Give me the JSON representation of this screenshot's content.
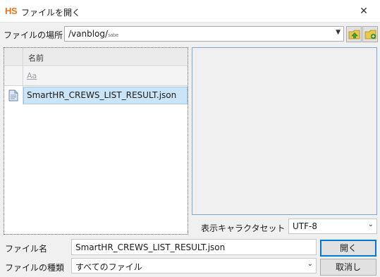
{
  "window": {
    "app_logo": "HS",
    "title": "ファイルを開く",
    "close_glyph": "✕"
  },
  "location": {
    "label": "ファイルの場所",
    "path": "/vanblog/",
    "path_tail": "sabe",
    "icons": [
      "folder-up-icon",
      "new-folder-icon"
    ]
  },
  "file_list": {
    "column_header": "名前",
    "filter_glyph": "Aa",
    "items": [
      {
        "name": "SmartHR_CREWS_LIST_RESULT.json",
        "icon": "document-icon",
        "selected": true
      }
    ]
  },
  "encoding": {
    "label": "表示キャラクタセット",
    "value": "UTF-8"
  },
  "filename": {
    "label": "ファイル名",
    "value": "SmartHR_CREWS_LIST_RESULT.json"
  },
  "filetype": {
    "label": "ファイルの種類",
    "value": "すべてのファイル"
  },
  "buttons": {
    "open": "開く",
    "cancel": "取消し"
  },
  "colors": {
    "selection": "#cce4f7",
    "logo": "#e8741a",
    "preview_border": "#7aa8d2"
  }
}
